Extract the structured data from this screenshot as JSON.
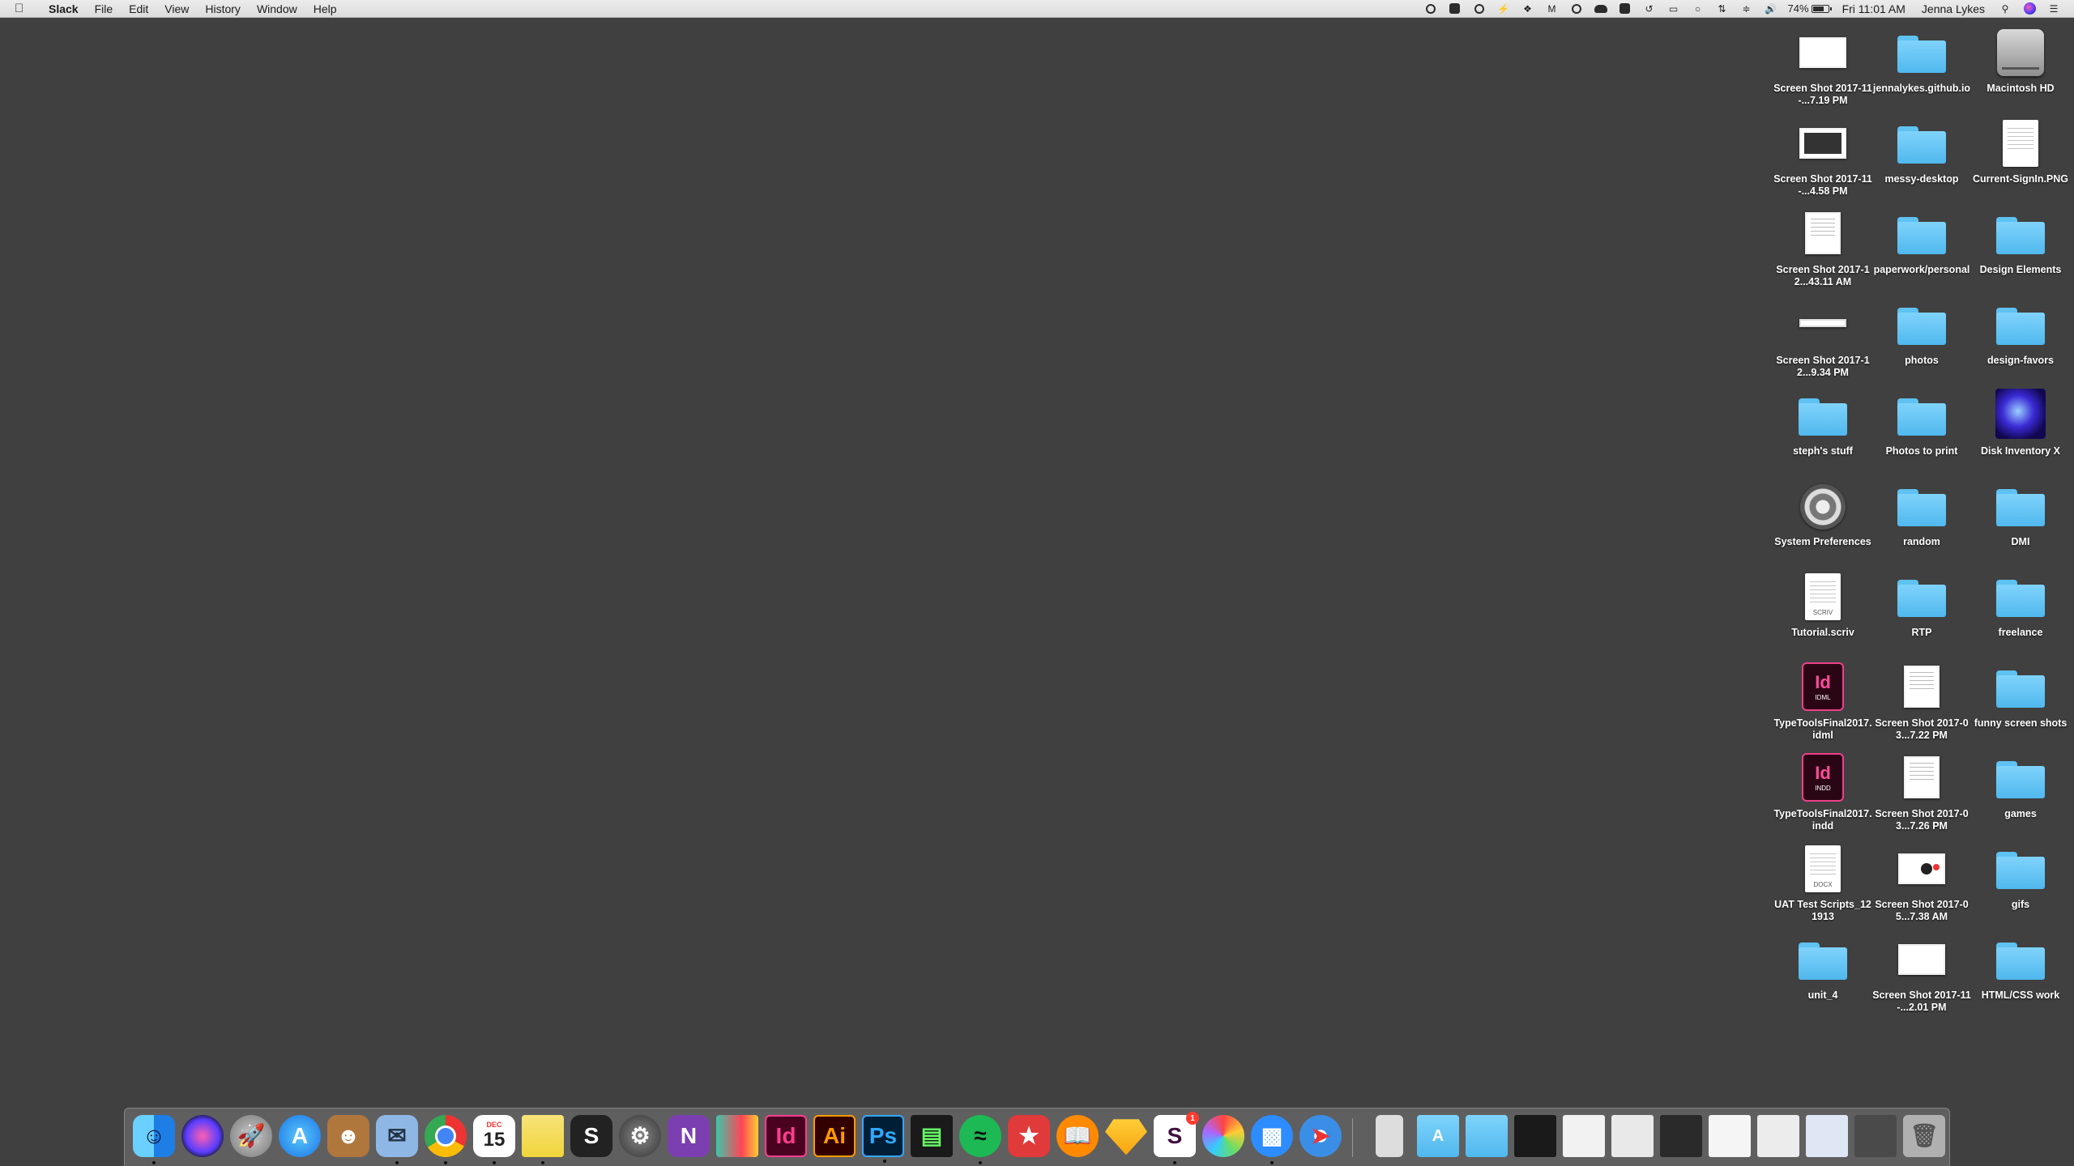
{
  "menubar": {
    "app_name": "Slack",
    "menus": [
      "File",
      "Edit",
      "View",
      "History",
      "Window",
      "Help"
    ],
    "battery_percent": "74%",
    "battery_level": 0.74,
    "clock": "Fri 11:01 AM",
    "user": "Jenna Lykes",
    "status_icons": [
      "screen-record-icon",
      "flipboard-icon",
      "creative-cloud-icon",
      "flux-icon",
      "dropbox-icon",
      "gmail-icon",
      "gauge-icon",
      "cloud-icon",
      "folder-icon",
      "time-machine-icon",
      "airplay-icon",
      "bluetooth-icon",
      "transfer-icon",
      "wifi-icon",
      "volume-icon"
    ]
  },
  "desktop": {
    "icons": [
      {
        "label": "Screen Shot 2017-11-...7.19 PM",
        "type": "screenshot"
      },
      {
        "label": "jennalykes.github.io",
        "type": "folder"
      },
      {
        "label": "Macintosh HD",
        "type": "drive"
      },
      {
        "label": "Screen Shot 2017-11-...4.58 PM",
        "type": "screenshot-dark"
      },
      {
        "label": "messy-desktop",
        "type": "folder"
      },
      {
        "label": "Current-SignIn.PNG",
        "type": "image-doc"
      },
      {
        "label": "Screen Shot 2017-12...43.11 AM",
        "type": "screenshot-doc"
      },
      {
        "label": "paperwork/personal",
        "type": "folder"
      },
      {
        "label": "Design Elements",
        "type": "folder"
      },
      {
        "label": "Screen Shot 2017-12...9.34 PM",
        "type": "screenshot-thin"
      },
      {
        "label": "photos",
        "type": "folder"
      },
      {
        "label": "design-favors",
        "type": "folder"
      },
      {
        "label": "steph's stuff",
        "type": "folder"
      },
      {
        "label": "Photos to print",
        "type": "folder"
      },
      {
        "label": "Disk Inventory X",
        "type": "app-disk"
      },
      {
        "label": "System Preferences",
        "type": "app-gear"
      },
      {
        "label": "random",
        "type": "folder"
      },
      {
        "label": "DMI",
        "type": "folder"
      },
      {
        "label": "Tutorial.scriv",
        "type": "file",
        "tag": "SCRIV"
      },
      {
        "label": "RTP",
        "type": "folder"
      },
      {
        "label": "freelance",
        "type": "folder"
      },
      {
        "label": "TypeToolsFinal2017.idml",
        "type": "indesign",
        "tag": "IDML"
      },
      {
        "label": "Screen Shot 2017-03...7.22 PM",
        "type": "screenshot-doc"
      },
      {
        "label": "funny screen shots",
        "type": "folder"
      },
      {
        "label": "TypeToolsFinal2017.indd",
        "type": "indesign",
        "tag": "INDD"
      },
      {
        "label": "Screen Shot 2017-03...7.26 PM",
        "type": "screenshot-doc"
      },
      {
        "label": "games",
        "type": "folder"
      },
      {
        "label": "UAT Test Scripts_121913",
        "type": "file",
        "tag": "DOCX"
      },
      {
        "label": "Screen Shot 2017-05...7.38 AM",
        "type": "screenshot-stats"
      },
      {
        "label": "gifs",
        "type": "folder"
      },
      {
        "label": "unit_4",
        "type": "folder"
      },
      {
        "label": "Screen Shot 2017-11-...2.01 PM",
        "type": "screenshot"
      },
      {
        "label": "HTML/CSS work",
        "type": "folder"
      }
    ]
  },
  "dock": {
    "indesign_glyph": "Id",
    "illustrator_glyph": "Ai",
    "photoshop_glyph": "Ps",
    "calendar_day": "15",
    "calendar_month": "DEC",
    "onenote_glyph": "N",
    "scrivener_glyph": "S",
    "slack_glyph": "S",
    "slack_badge": "1"
  }
}
